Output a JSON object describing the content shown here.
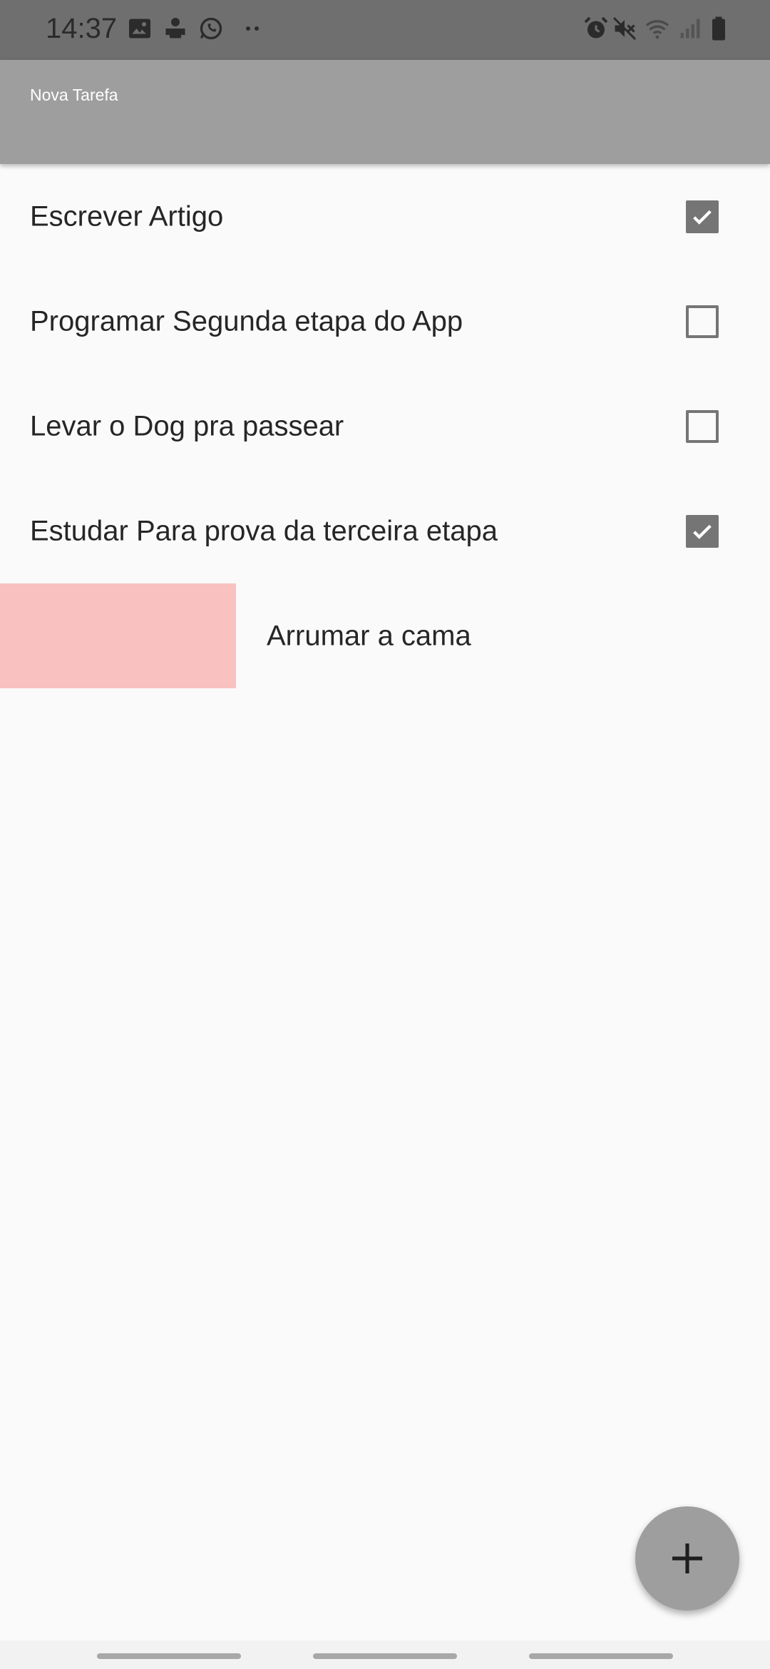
{
  "status_bar": {
    "time": "14:37",
    "left_icons": [
      "image-icon",
      "android-icon",
      "whatsapp-icon",
      "more-dots-icon"
    ],
    "right_icons": [
      "alarm-icon",
      "mute-icon",
      "wifi-icon",
      "signal-icon",
      "battery-icon"
    ]
  },
  "app_bar": {
    "title": "Nova Tarefa"
  },
  "tasks": [
    {
      "label": "Escrever Artigo",
      "checked": true
    },
    {
      "label": "Programar Segunda etapa do App",
      "checked": false
    },
    {
      "label": "Levar o Dog pra passear",
      "checked": false
    },
    {
      "label": "Estudar Para prova da terceira etapa",
      "checked": true
    },
    {
      "label": "Arrumar a cama",
      "swiping": true
    }
  ],
  "colors": {
    "status_bar": "#6f6f6f",
    "app_bar": "#9e9e9e",
    "checkbox": "#757575",
    "swipe_delete_bg": "#f9c1c0",
    "fab": "#9e9e9e"
  },
  "fab": {
    "icon": "add-icon"
  }
}
